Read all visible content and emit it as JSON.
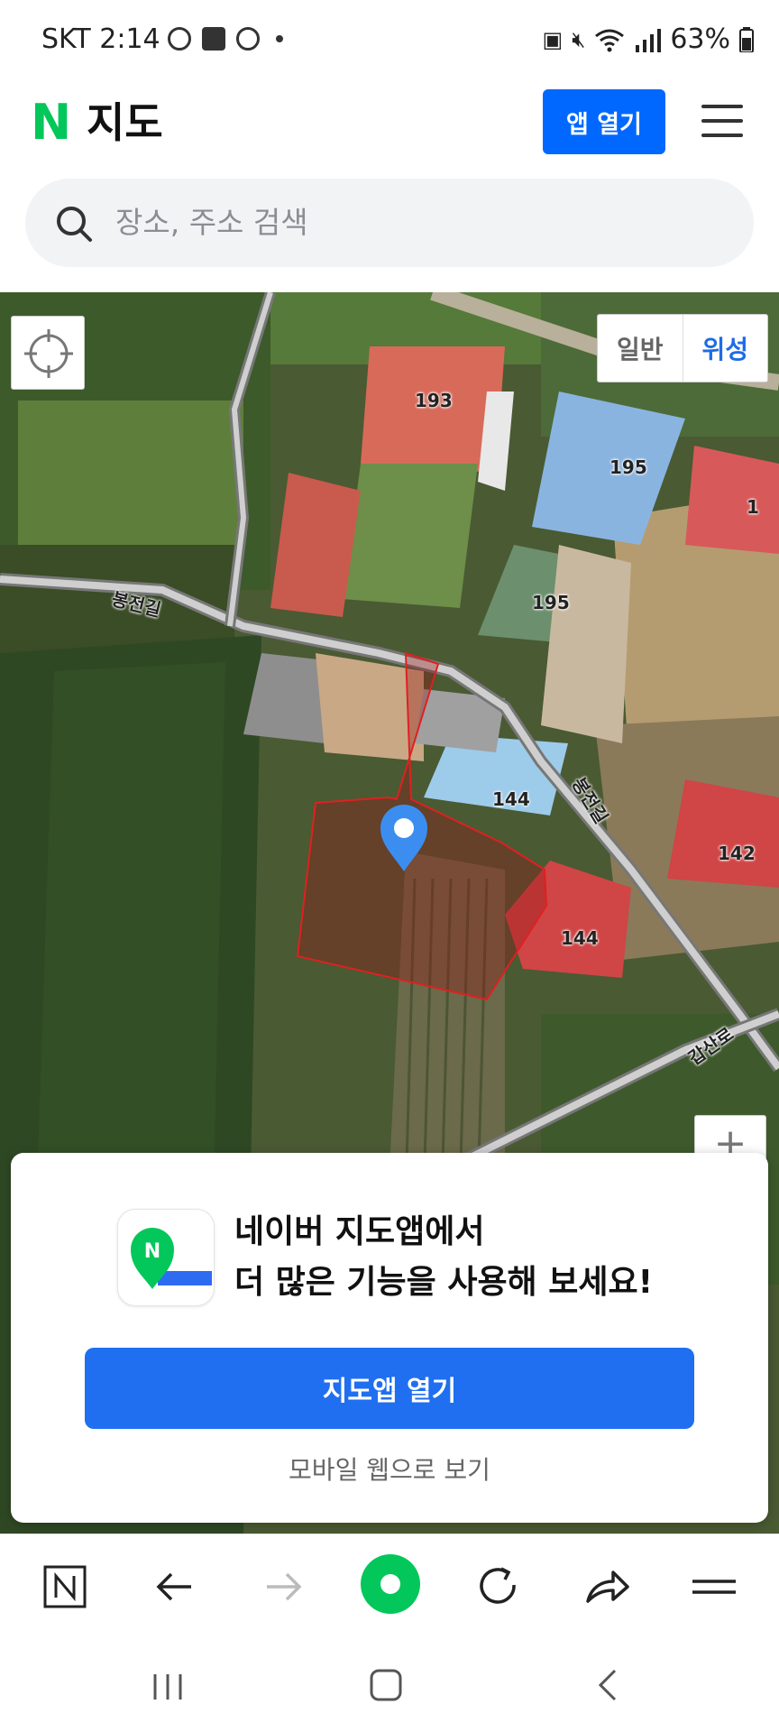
{
  "status_bar": {
    "carrier_time": "SKT 2:14",
    "battery": "63%"
  },
  "header": {
    "logo_n": "N",
    "logo_text": "지도",
    "open_app_label": "앱 열기"
  },
  "search": {
    "placeholder": "장소, 주소 검색"
  },
  "map": {
    "type_toggle": [
      "일반",
      "위성"
    ],
    "selected_type": "위성",
    "road_labels": [
      "봉전길",
      "봉전길",
      "갑산로"
    ],
    "building_numbers": [
      "193",
      "195",
      "195",
      "1",
      "144",
      "144",
      "142"
    ],
    "zoom_in_label": "+"
  },
  "promo": {
    "line1": "네이버 지도앱에서",
    "line2": "더 많은 기능을 사용해 보세요!",
    "cta_label": "지도앱 열기",
    "web_link_label": "모바일 웹으로 보기",
    "icon_letter": "N"
  },
  "colors": {
    "naver_green": "#03c75a",
    "primary_blue": "#0068ff",
    "cta_blue": "#1f6ff0",
    "parcel_red": "#e02020"
  }
}
